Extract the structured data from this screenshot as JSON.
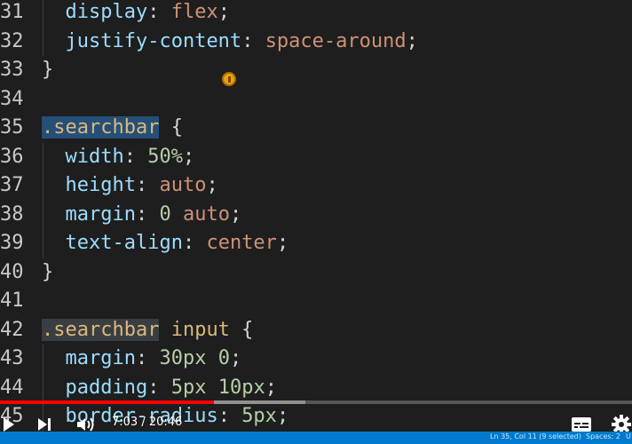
{
  "lines": [
    {
      "n": "31",
      "indent": true,
      "tokens": [
        {
          "t": "display",
          "c": "prop"
        },
        {
          "t": ": ",
          "c": "punc"
        },
        {
          "t": "flex",
          "c": "val"
        },
        {
          "t": ";",
          "c": "punc"
        }
      ]
    },
    {
      "n": "32",
      "indent": true,
      "tokens": [
        {
          "t": "justify-content",
          "c": "prop"
        },
        {
          "t": ": ",
          "c": "punc"
        },
        {
          "t": "space-around",
          "c": "val"
        },
        {
          "t": ";",
          "c": "punc"
        }
      ]
    },
    {
      "n": "33",
      "indent": false,
      "tokens": [
        {
          "t": "}",
          "c": "punc"
        }
      ]
    },
    {
      "n": "34",
      "indent": false,
      "tokens": []
    },
    {
      "n": "35",
      "indent": false,
      "tokens": [
        {
          "t": ".searchbar",
          "c": "sel",
          "hl": "hl-sel"
        },
        {
          "t": " {",
          "c": "punc"
        }
      ]
    },
    {
      "n": "36",
      "indent": true,
      "tokens": [
        {
          "t": "width",
          "c": "prop"
        },
        {
          "t": ": ",
          "c": "punc"
        },
        {
          "t": "50%",
          "c": "num"
        },
        {
          "t": ";",
          "c": "punc"
        }
      ]
    },
    {
      "n": "37",
      "indent": true,
      "tokens": [
        {
          "t": "height",
          "c": "prop"
        },
        {
          "t": ": ",
          "c": "punc"
        },
        {
          "t": "auto",
          "c": "val"
        },
        {
          "t": ";",
          "c": "punc"
        }
      ]
    },
    {
      "n": "38",
      "indent": true,
      "tokens": [
        {
          "t": "margin",
          "c": "prop"
        },
        {
          "t": ": ",
          "c": "punc"
        },
        {
          "t": "0",
          "c": "num"
        },
        {
          "t": " ",
          "c": "punc"
        },
        {
          "t": "auto",
          "c": "val"
        },
        {
          "t": ";",
          "c": "punc"
        }
      ]
    },
    {
      "n": "39",
      "indent": true,
      "tokens": [
        {
          "t": "text-align",
          "c": "prop"
        },
        {
          "t": ": ",
          "c": "punc"
        },
        {
          "t": "center",
          "c": "val"
        },
        {
          "t": ";",
          "c": "punc"
        }
      ]
    },
    {
      "n": "40",
      "indent": false,
      "tokens": [
        {
          "t": "}",
          "c": "punc"
        }
      ]
    },
    {
      "n": "41",
      "indent": false,
      "tokens": []
    },
    {
      "n": "42",
      "indent": false,
      "tokens": [
        {
          "t": ".searchbar",
          "c": "sel",
          "hl": "hl-match"
        },
        {
          "t": " ",
          "c": "punc"
        },
        {
          "t": "input",
          "c": "sel"
        },
        {
          "t": " {",
          "c": "punc"
        }
      ]
    },
    {
      "n": "43",
      "indent": true,
      "tokens": [
        {
          "t": "margin",
          "c": "prop"
        },
        {
          "t": ": ",
          "c": "punc"
        },
        {
          "t": "30px",
          "c": "num"
        },
        {
          "t": " ",
          "c": "punc"
        },
        {
          "t": "0",
          "c": "num"
        },
        {
          "t": ";",
          "c": "punc"
        }
      ]
    },
    {
      "n": "44",
      "indent": true,
      "tokens": [
        {
          "t": "padding",
          "c": "prop"
        },
        {
          "t": ": ",
          "c": "punc"
        },
        {
          "t": "5px",
          "c": "num"
        },
        {
          "t": " ",
          "c": "punc"
        },
        {
          "t": "10px",
          "c": "num"
        },
        {
          "t": ";",
          "c": "punc"
        }
      ]
    },
    {
      "n": "45",
      "indent": true,
      "tokens": [
        {
          "t": "border-radius",
          "c": "prop"
        },
        {
          "t": ": ",
          "c": "punc"
        },
        {
          "t": "5px",
          "c": "num"
        },
        {
          "t": ";",
          "c": "punc"
        }
      ]
    }
  ],
  "player": {
    "time": "7:03 / 20:46",
    "progress": 0.3387,
    "buffered": 0.4832,
    "icons": [
      "play-icon",
      "next-icon",
      "volume-icon",
      "subtitles-icon",
      "settings-icon"
    ]
  },
  "statusbar": {
    "position": "Ln 35, Col 11 (9 selected)",
    "spaces": "Spaces: 2",
    "encoding": "U"
  },
  "colors": {
    "background": "#1e1e1e",
    "selector": "#d7ba7d",
    "property": "#9cdcfe",
    "number": "#b5cea8",
    "value": "#ce9178",
    "progress": "#ff0000",
    "statusbar": "#007acc"
  }
}
